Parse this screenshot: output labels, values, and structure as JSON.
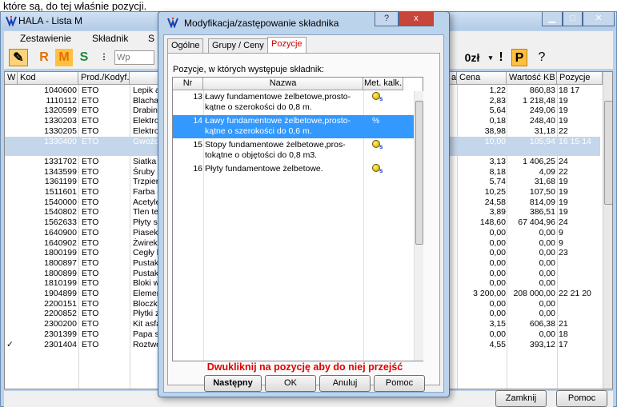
{
  "caption_top": "które są, do tej właśnie pozycji.",
  "main": {
    "title": "HALA - Lista M",
    "menu": [
      "Zestawienie",
      "Składnik",
      "S"
    ],
    "toolbar": {
      "r": "R",
      "m": "M",
      "s": "S",
      "search": "Wp",
      "zl": "0zł",
      "bang": "!",
      "p": "P",
      "help": "?"
    },
    "cols": {
      "w": "W",
      "kod": "Kod",
      "prod": "Prod./Kodyf.",
      "a": "a",
      "cena": "Cena",
      "wartosc": "Wartość KB",
      "pozycje": "Pozycje"
    },
    "rows": [
      {
        "kod": "1040600",
        "prod": "ETO",
        "name": "Lepik a",
        "cena": "1,22",
        "wartosc": "860,83",
        "poz": "18 17",
        "sel": false,
        "chk": ""
      },
      {
        "kod": "1110112",
        "prod": "ETO",
        "name": "Blacha",
        "cena": "2,83",
        "wartosc": "1 218,48",
        "poz": "19",
        "sel": false,
        "chk": ""
      },
      {
        "kod": "1320599",
        "prod": "ETO",
        "name": "Drabiny",
        "cena": "5,64",
        "wartosc": "249,06",
        "poz": "19",
        "sel": false,
        "chk": ""
      },
      {
        "kod": "1330203",
        "prod": "ETO",
        "name": "Elektroc",
        "cena": "0,18",
        "wartosc": "248,40",
        "poz": "19",
        "sel": false,
        "chk": ""
      },
      {
        "kod": "1330205",
        "prod": "ETO",
        "name": "Elektroc",
        "cena": "38,98",
        "wartosc": "31,18",
        "poz": "22",
        "sel": false,
        "chk": ""
      },
      {
        "kod": "1330400",
        "prod": "ETO",
        "name": "Gwoździ",
        "cena": "10,00",
        "wartosc": "105,94",
        "poz": "16 15 14",
        "sel": true,
        "chk": ""
      },
      {
        "kod": "",
        "prod": "",
        "name": "",
        "cena": "",
        "wartosc": "",
        "poz": "",
        "sel": true,
        "chk": ""
      },
      {
        "kod": "1331702",
        "prod": "ETO",
        "name": "Siatka F",
        "cena": "3,13",
        "wartosc": "1 406,25",
        "poz": "24",
        "sel": false,
        "chk": ""
      },
      {
        "kod": "1343599",
        "prod": "ETO",
        "name": "Śruby z",
        "cena": "8,18",
        "wartosc": "4,09",
        "poz": "22",
        "sel": false,
        "chk": ""
      },
      {
        "kod": "1361199",
        "prod": "ETO",
        "name": "Trzpieni",
        "cena": "5,74",
        "wartosc": "31,68",
        "poz": "19",
        "sel": false,
        "chk": ""
      },
      {
        "kod": "1511601",
        "prod": "ETO",
        "name": "Farba o",
        "cena": "10,25",
        "wartosc": "107,50",
        "poz": "19",
        "sel": false,
        "chk": ""
      },
      {
        "kod": "1540000",
        "prod": "ETO",
        "name": "Acetyler",
        "cena": "24,58",
        "wartosc": "814,09",
        "poz": "19",
        "sel": false,
        "chk": ""
      },
      {
        "kod": "1540802",
        "prod": "ETO",
        "name": "Tlen tec",
        "cena": "3,89",
        "wartosc": "386,51",
        "poz": "19",
        "sel": false,
        "chk": ""
      },
      {
        "kod": "1562633",
        "prod": "ETO",
        "name": "Płyty st",
        "cena": "148,60",
        "wartosc": "67 404,96",
        "poz": "24",
        "sel": false,
        "chk": ""
      },
      {
        "kod": "1640900",
        "prod": "ETO",
        "name": "Piasek I",
        "cena": "0,00",
        "wartosc": "0,00",
        "poz": "9",
        "sel": false,
        "chk": ""
      },
      {
        "kod": "1640902",
        "prod": "ETO",
        "name": "Żwirek I",
        "cena": "0,00",
        "wartosc": "0,00",
        "poz": "9",
        "sel": false,
        "chk": ""
      },
      {
        "kod": "1800199",
        "prod": "ETO",
        "name": "Cegły b",
        "cena": "0,00",
        "wartosc": "0,00",
        "poz": "23",
        "sel": false,
        "chk": ""
      },
      {
        "kod": "1800897",
        "prod": "ETO",
        "name": "Pustaki",
        "cena": "0,00",
        "wartosc": "0,00",
        "poz": "",
        "sel": false,
        "chk": ""
      },
      {
        "kod": "1800899",
        "prod": "ETO",
        "name": "Pustaki",
        "cena": "0,00",
        "wartosc": "0,00",
        "poz": "",
        "sel": false,
        "chk": ""
      },
      {
        "kod": "1810199",
        "prod": "ETO",
        "name": "Bloki wi",
        "cena": "0,00",
        "wartosc": "0,00",
        "poz": "",
        "sel": false,
        "chk": ""
      },
      {
        "kod": "1904899",
        "prod": "ETO",
        "name": "Element",
        "cena": "3 200,00",
        "wartosc": "208 000,00",
        "poz": "22 21 20",
        "sel": false,
        "chk": ""
      },
      {
        "kod": "2200151",
        "prod": "ETO",
        "name": "Bloczki",
        "cena": "0,00",
        "wartosc": "0,00",
        "poz": "",
        "sel": false,
        "chk": ""
      },
      {
        "kod": "2200852",
        "prod": "ETO",
        "name": "Płytki z",
        "cena": "0,00",
        "wartosc": "0,00",
        "poz": "",
        "sel": false,
        "chk": ""
      },
      {
        "kod": "2300200",
        "prod": "ETO",
        "name": "Kit asfal",
        "cena": "3,15",
        "wartosc": "606,38",
        "poz": "21",
        "sel": false,
        "chk": ""
      },
      {
        "kod": "2301399",
        "prod": "ETO",
        "name": "Papa sn",
        "cena": "0,00",
        "wartosc": "0,00",
        "poz": "18",
        "sel": false,
        "chk": ""
      },
      {
        "kod": "2301404",
        "prod": "ETO",
        "name": "Roztwó",
        "cena": "4,55",
        "wartosc": "393,12",
        "poz": "17",
        "sel": false,
        "chk": "✓"
      }
    ],
    "btn_close": "Zamknij",
    "btn_help": "Pomoc"
  },
  "dialog": {
    "title": "Modyfikacja/zastępowanie składnika",
    "tabs": [
      "Ogólne",
      "Grupy / Ceny",
      "Pozycje"
    ],
    "label": "Pozycje, w których występuje składnik:",
    "cols": {
      "nr": "Nr",
      "nazwa": "Nazwa",
      "met": "Met. kalk."
    },
    "items": [
      {
        "nr": "13",
        "line1": "Ławy fundamentowe żelbetowe,prosto-",
        "line2": "kątne o szerokości do 0,8 m.",
        "met": "coin",
        "sel": false
      },
      {
        "nr": "14",
        "line1": "Ławy fundamentowe żelbetowe,prosto-",
        "line2": "kątne o szerokości do 0,6 m.",
        "met": "%",
        "sel": true
      },
      {
        "nr": "15",
        "line1": "Stopy fundamentowe żelbetowe,pros-",
        "line2": "tokątne o objętości do 0,8 m3.",
        "met": "coin",
        "sel": false
      },
      {
        "nr": "16",
        "line1": "Płyty fundamentowe żelbetowe.",
        "line2": "",
        "met": "coin",
        "sel": false
      }
    ],
    "hint": "Dwukliknij na pozycję aby do niej przejść",
    "buttons": {
      "next": "Następny",
      "ok": "OK",
      "cancel": "Anuluj",
      "help": "Pomoc"
    },
    "help_q": "?",
    "close_x": "x",
    "accent": "#3399ff",
    "hint_color": "#e00000"
  }
}
